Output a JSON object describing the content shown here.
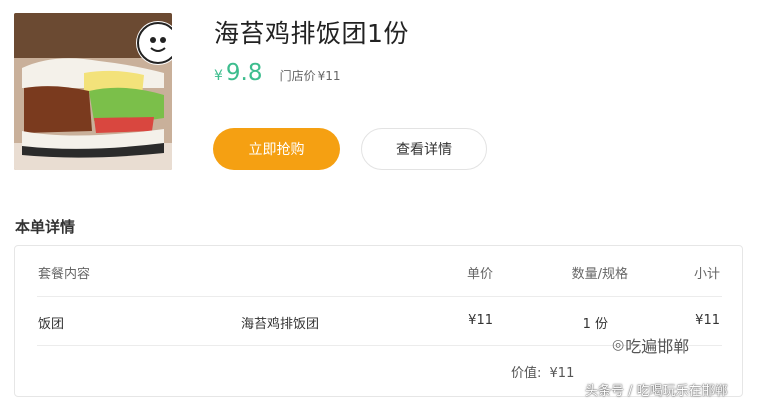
{
  "product": {
    "title": "海苔鸡排饭团1份",
    "currency": "¥",
    "price": "9.8",
    "store_price_label": "门店价",
    "store_price": "¥11"
  },
  "actions": {
    "buy_label": "立即抢购",
    "detail_label": "查看详情"
  },
  "order": {
    "section_title": "本单详情",
    "headers": [
      "套餐内容",
      "单价",
      "数量/规格",
      "小计"
    ],
    "rows": [
      {
        "category": "饭团",
        "name": "海苔鸡排饭团",
        "unit_price": "¥11",
        "qty": "1 份",
        "subtotal": "¥11"
      }
    ],
    "total_label": "价值:",
    "total_value": "¥11"
  },
  "watermark": {
    "account": "吃遍邯郸",
    "source": "头条号 / 吃喝玩乐在邯郸"
  },
  "colors": {
    "accent": "#f5a012",
    "price": "#3dbd8e"
  },
  "icons": [
    "product-image",
    "wechat-icon"
  ]
}
